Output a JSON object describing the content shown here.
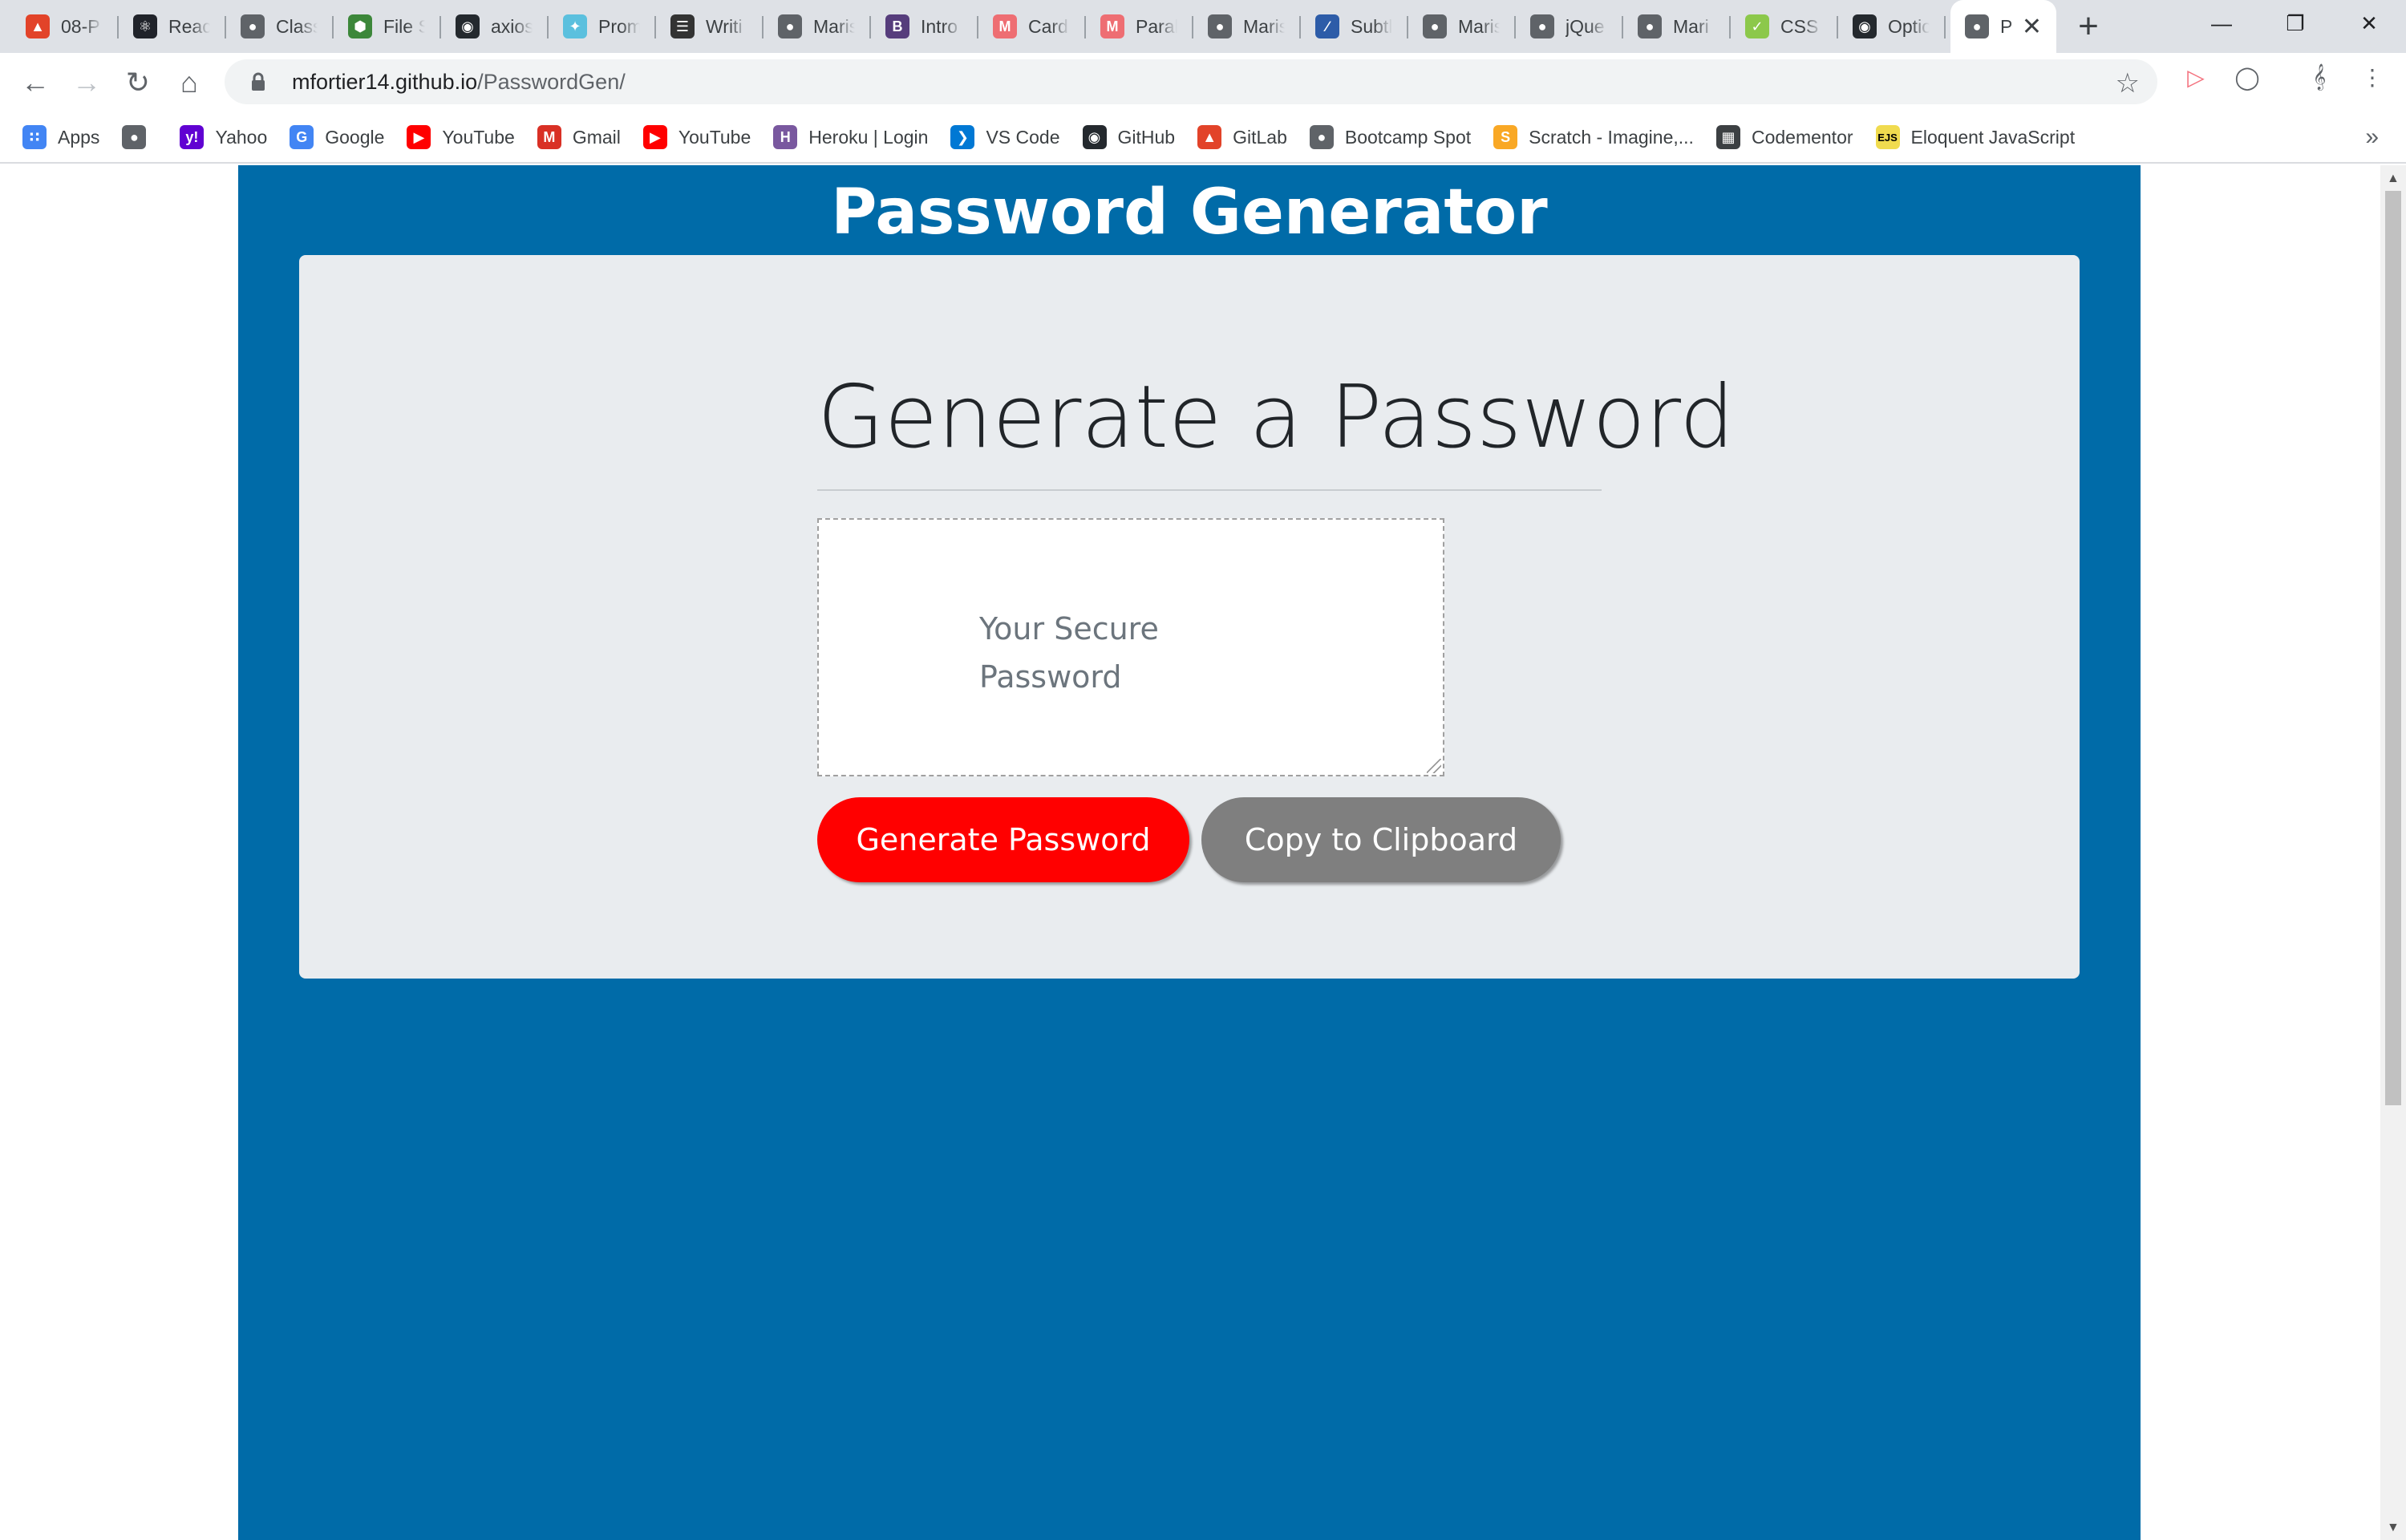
{
  "browser": {
    "tabs": [
      {
        "label": "08-P",
        "icon": "gitlab-icon",
        "color": "#e24329"
      },
      {
        "label": "React",
        "icon": "react-icon",
        "color": "#20232a"
      },
      {
        "label": "Class",
        "icon": "globe-icon",
        "color": "#5f6368"
      },
      {
        "label": "File S",
        "icon": "node-icon",
        "color": "#3c873a"
      },
      {
        "label": "axios",
        "icon": "github-icon",
        "color": "#24292e"
      },
      {
        "label": "Prom",
        "icon": "bird-icon",
        "color": "#5bc0de"
      },
      {
        "label": "Writi",
        "icon": "doc-icon",
        "color": "#333333"
      },
      {
        "label": "Maris",
        "icon": "globe-icon",
        "color": "#5f6368"
      },
      {
        "label": "Intro",
        "icon": "bootstrap-icon",
        "color": "#563d7c"
      },
      {
        "label": "Card",
        "icon": "materialize-icon",
        "color": "#ee6e73"
      },
      {
        "label": "Paral",
        "icon": "materialize-icon",
        "color": "#ee6e73"
      },
      {
        "label": "Maris",
        "icon": "globe-icon",
        "color": "#5f6368"
      },
      {
        "label": "Subtl",
        "icon": "subtle-icon",
        "color": "#2d5ca8"
      },
      {
        "label": "Maris",
        "icon": "globe-icon",
        "color": "#5f6368"
      },
      {
        "label": "jQue",
        "icon": "globe-icon",
        "color": "#5f6368"
      },
      {
        "label": "Mari",
        "icon": "globe-icon",
        "color": "#5f6368"
      },
      {
        "label": "CSS I",
        "icon": "css-icon",
        "color": "#8cc84b"
      },
      {
        "label": "Optio",
        "icon": "github-icon",
        "color": "#24292e"
      }
    ],
    "active_tab": {
      "label": "P",
      "icon": "globe-icon",
      "close": "✕"
    },
    "new_tab": "+",
    "address": {
      "host": "mfortier14.github.io",
      "path": "/PasswordGen/"
    },
    "bookmarks": [
      {
        "label": "Apps",
        "icon": "apps-grid-icon",
        "color": "#4285f4"
      },
      {
        "label": "",
        "icon": "globe-icon",
        "color": "#5f6368"
      },
      {
        "label": "Yahoo",
        "icon": "yahoo-icon",
        "color": "#6001d2"
      },
      {
        "label": "Google",
        "icon": "google-icon",
        "color": "#4285f4"
      },
      {
        "label": "YouTube",
        "icon": "youtube-icon",
        "color": "#ff0000"
      },
      {
        "label": "Gmail",
        "icon": "gmail-icon",
        "color": "#d93025"
      },
      {
        "label": "YouTube",
        "icon": "youtube-icon",
        "color": "#ff0000"
      },
      {
        "label": "Heroku | Login",
        "icon": "heroku-icon",
        "color": "#79589f"
      },
      {
        "label": "VS Code",
        "icon": "vscode-icon",
        "color": "#0078d4"
      },
      {
        "label": "GitHub",
        "icon": "github-icon",
        "color": "#24292e"
      },
      {
        "label": "GitLab",
        "icon": "gitlab-icon",
        "color": "#e24329"
      },
      {
        "label": "Bootcamp Spot",
        "icon": "globe-icon",
        "color": "#5f6368"
      },
      {
        "label": "Scratch - Imagine,...",
        "icon": "scratch-icon",
        "color": "#f9a825"
      },
      {
        "label": "Codementor",
        "icon": "codementor-icon",
        "color": "#3c4043"
      },
      {
        "label": "Eloquent JavaScript",
        "icon": "ejs-icon",
        "color": "#f0db4f"
      }
    ]
  },
  "page": {
    "site_title": "Password Generator",
    "card_heading": "Generate a Password",
    "password_placeholder": "Your Secure Password",
    "generate_button": "Generate Password",
    "copy_button": "Copy to Clipboard",
    "colors": {
      "background": "#006ba8",
      "card": "#e9ecef",
      "generate": "#ff0000",
      "copy": "#7f7f7f"
    }
  }
}
